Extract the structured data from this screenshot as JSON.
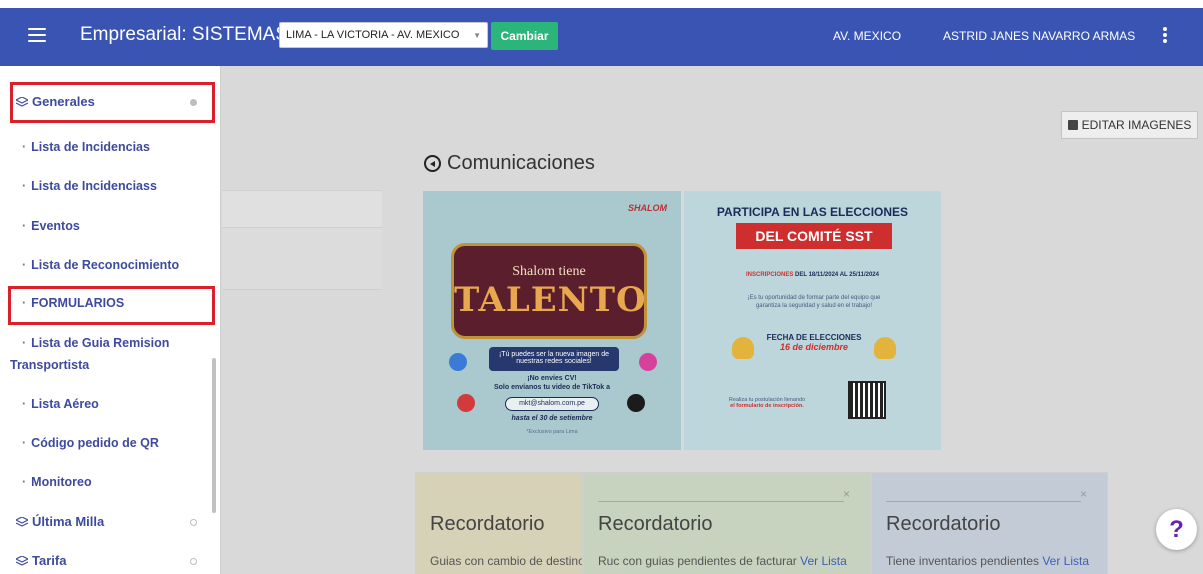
{
  "header": {
    "title": "Empresarial: SISTEMAS",
    "branch_select_value": "LIMA - LA VICTORIA - AV. MEXICO",
    "change_button": "Cambiar",
    "location_link": "AV. MEXICO",
    "user_link": "ASTRID JANES NAVARRO ARMAS"
  },
  "sidebar": {
    "groups": {
      "generales": "Generales",
      "ultima_milla": "Última Milla",
      "tarifa": "Tarifa"
    },
    "items": [
      "Lista de Incidencias",
      "Lista de Incidenciass",
      "Eventos",
      "Lista de Reconocimiento",
      "FORMULARIOS",
      "Lista de Guia Remision",
      "Transportista",
      "Lista Aéreo",
      "Código pedido de QR",
      "Monitoreo"
    ],
    "bullet": "·"
  },
  "main": {
    "edit_images_button": "EDITAR IMAGENES",
    "section_title": "Comunicaciones",
    "banner_talent": {
      "brand": "SHALOM",
      "sub": "Shalom tiene",
      "main": "TALENTO",
      "box_text": "¡Tú puedes ser la nueva imagen de nuestras redes sociales!",
      "line1": "¡No envíes CV!",
      "line2": "Solo envíanos tu video de TikTok a",
      "email": "mkt@shalom.com.pe",
      "deadline": "hasta el 30 de setiembre",
      "note": "*Exclusivo para Lima"
    },
    "banner_sst": {
      "title1": "PARTICIPA EN LAS ELECCIONES",
      "ribbon": "DEL COMITÉ SST",
      "dates_label": "INSCRIPCIONES",
      "dates": "DEL 18/11/2024 AL 25/11/2024",
      "small1": "¡Es tu oportunidad de formar parte del equipo que",
      "small2": "garantiza la seguridad y salud en el trabajo!",
      "fecha_label": "FECHA DE ELECCIONES",
      "fecha_value": "16 de diciembre",
      "reg1": "Realiza tu postulación llenando",
      "reg2": "el formulario de inscripción."
    },
    "cards": [
      {
        "title": "Recordatorio",
        "text": "Guias con cambio de destino",
        "link": ""
      },
      {
        "title": "Recordatorio",
        "text": "Ruc con guias pendientes de facturar ",
        "link": "Ver Lista",
        "close": "×"
      },
      {
        "title": "Recordatorio",
        "text": "Tiene inventarios pendientes ",
        "link": "Ver Lista",
        "close": "×"
      }
    ],
    "help": "?"
  },
  "colors": {
    "topbar": "#3a54b4",
    "accent_green": "#2bb57a",
    "highlight_red": "#d9202b",
    "sidebar_text": "#3e4a9e"
  }
}
